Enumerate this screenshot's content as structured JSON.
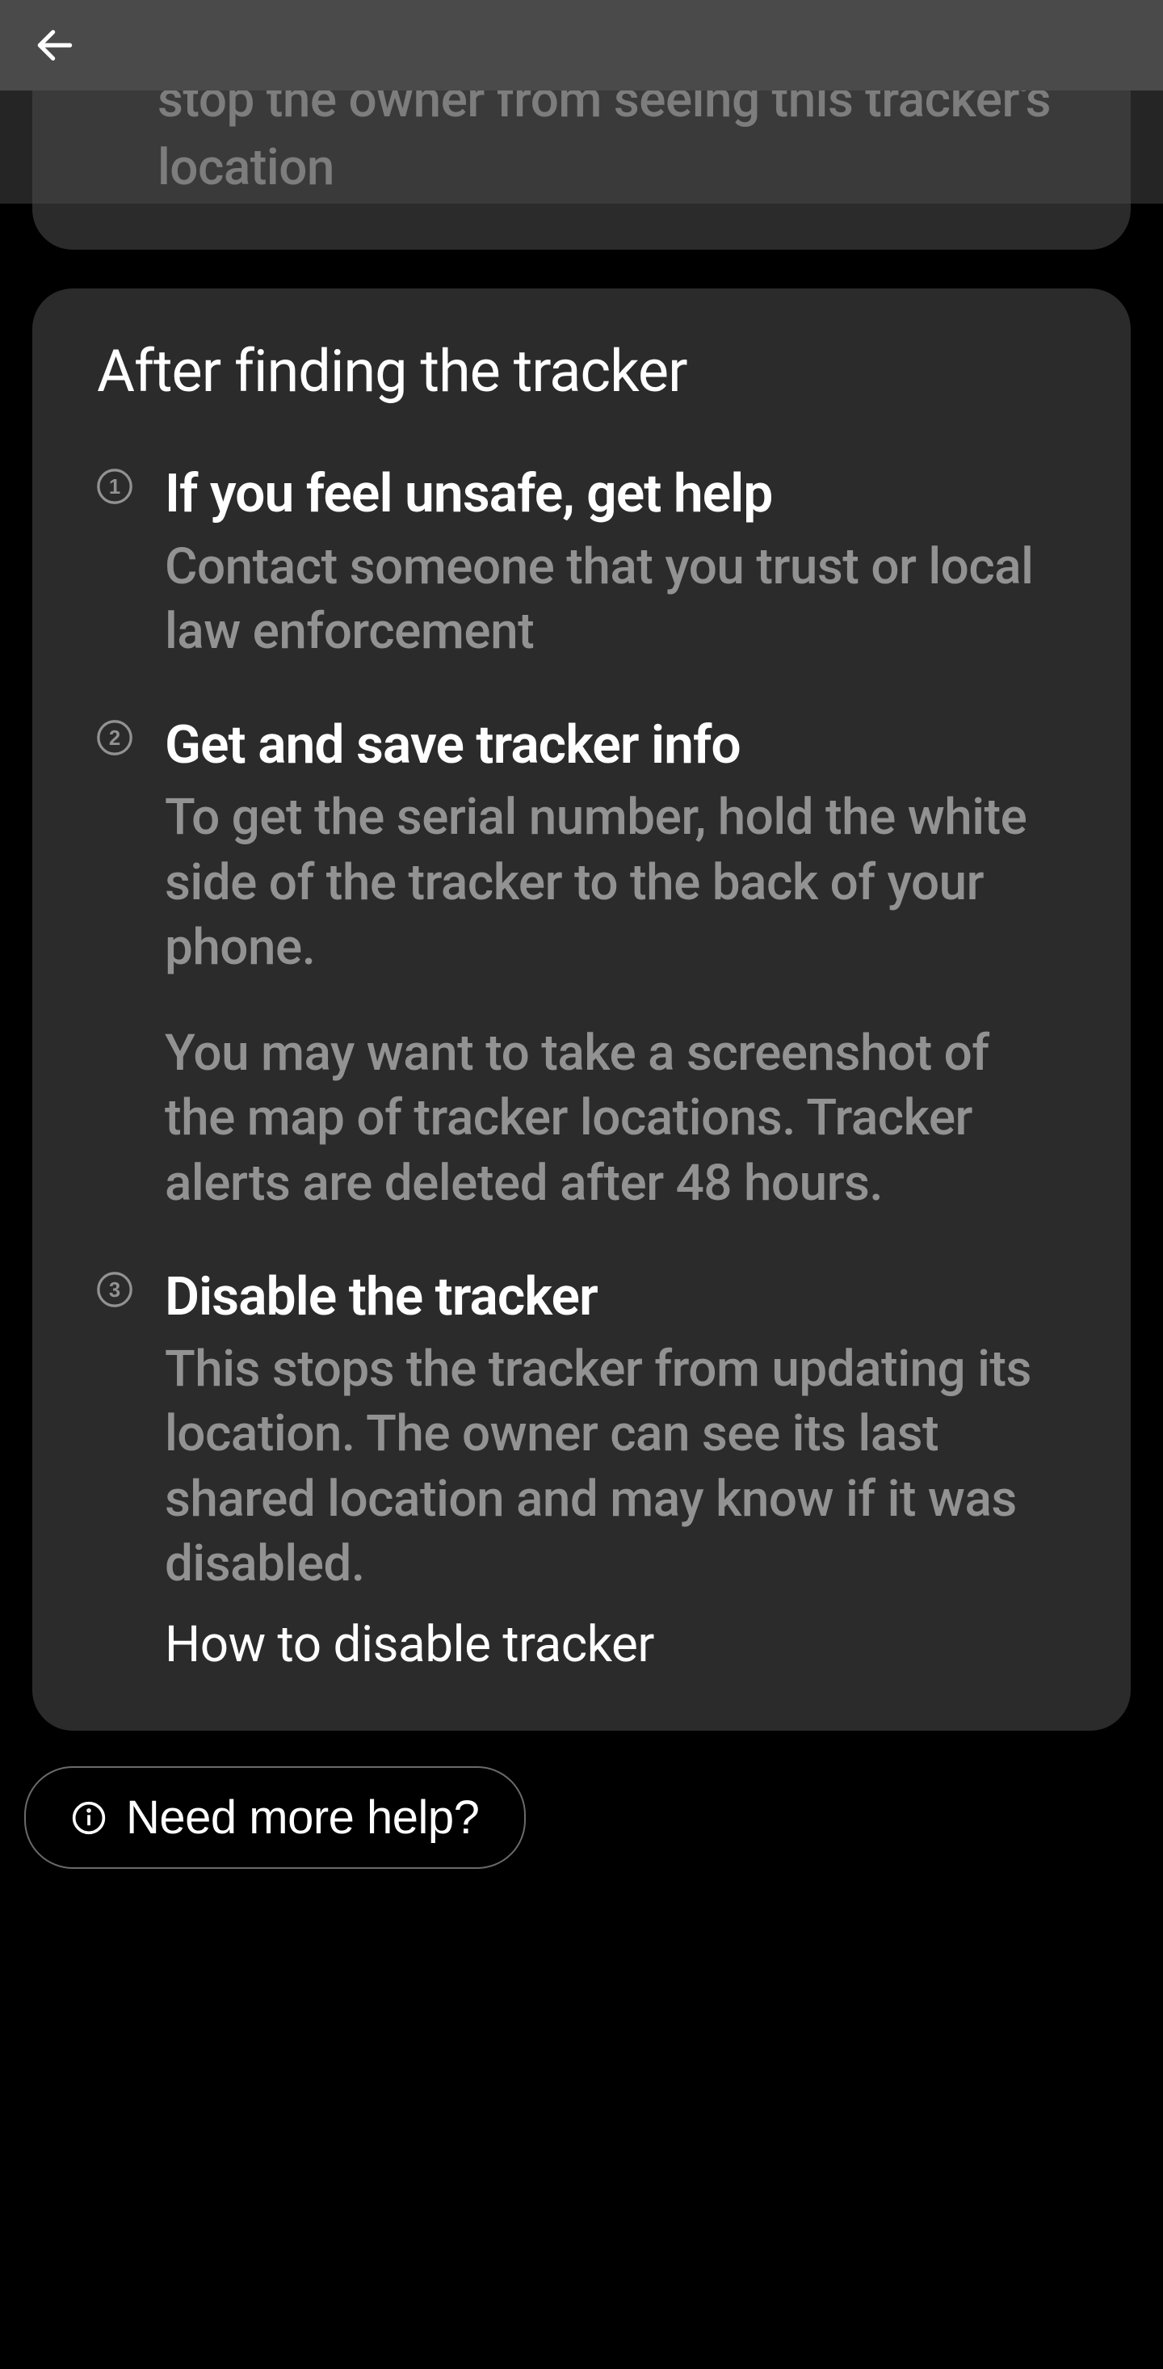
{
  "partial_card": {
    "text": "stop the owner from seeing this tracker's location"
  },
  "card": {
    "title": "After finding the tracker",
    "steps": [
      {
        "heading": "If you feel unsafe, get help",
        "desc": "Contact someone that you trust or local law enforcement"
      },
      {
        "heading": "Get and save tracker info",
        "desc": "To get the serial number, hold the white side of the tracker to the back of your phone.",
        "desc2": "You may want to take a screenshot of the map of tracker locations. Tracker alerts are deleted after 48 hours."
      },
      {
        "heading": "Disable the tracker",
        "desc": "This stops the tracker from updating its location. The owner can see its last shared location and may know if it was disabled.",
        "link": "How to disable tracker"
      }
    ]
  },
  "help_button": "Need more help?"
}
